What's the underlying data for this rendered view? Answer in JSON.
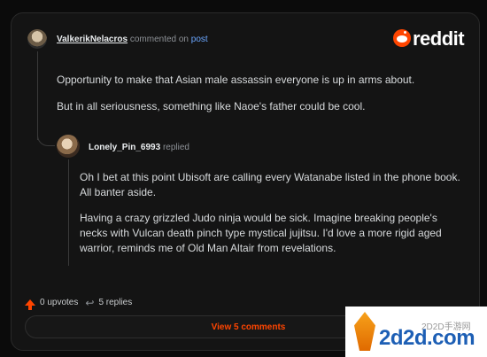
{
  "comment": {
    "author": "ValkerikNelacros",
    "action_text": "commented on",
    "target_text": "post",
    "paragraphs": [
      "Opportunity to make that Asian male assassin everyone is up in arms about.",
      "But in all seriousness, something like Naoe's father could be cool."
    ]
  },
  "reply": {
    "author": "Lonely_Pin_6993",
    "action_text": "replied",
    "paragraphs": [
      "Oh I bet at this point Ubisoft are calling every Watanabe listed in the phone book. All banter aside.",
      "Having a crazy grizzled Judo ninja would be sick.   Imagine breaking people's necks with Vulcan death pinch type mystical jujitsu. I'd love a more rigid aged warrior, reminds me of Old Man Altair from revelations."
    ]
  },
  "footer": {
    "upvotes_text": "0 upvotes",
    "replies_text": "5 replies",
    "view_comments_label": "View 5 comments"
  },
  "brand": {
    "name": "reddit"
  },
  "watermark": {
    "small_text": "2D2D手游网",
    "big_text": "2d2d.com"
  },
  "colors": {
    "accent": "#ff4500",
    "background": "#0b0b0b",
    "card": "#141414"
  },
  "icons": {
    "upvote": "upvote-arrow-icon",
    "replies": "reply-arrow-icon",
    "brand": "reddit-logo-icon"
  }
}
